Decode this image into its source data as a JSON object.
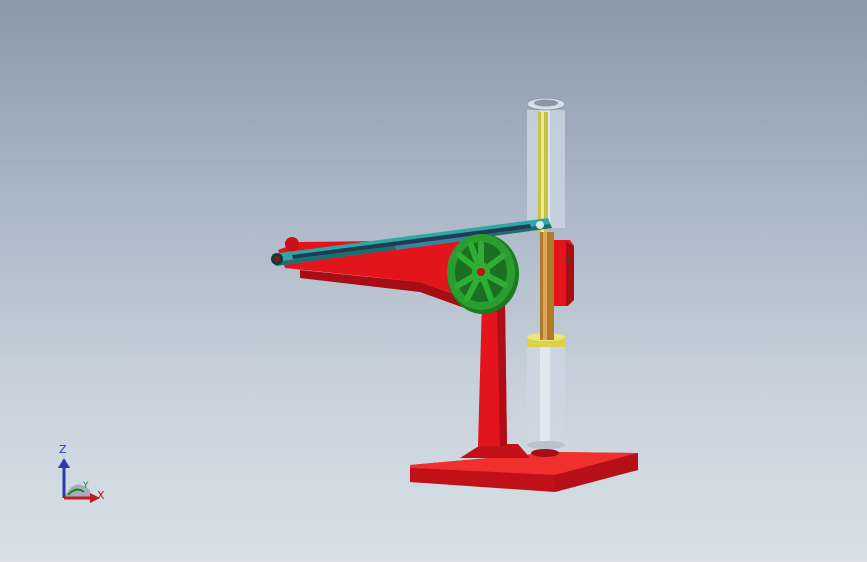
{
  "viewport": {
    "background_top": "#8a98aa",
    "background_bottom": "#d8dfe6"
  },
  "model": {
    "colors": {
      "frame_red": "#e3141c",
      "frame_red_dark": "#a80d14",
      "arm_teal": "#2fa7a6",
      "wheel_green": "#2b9c2f",
      "rod_yellow": "#c9c24a",
      "tube_glass": "#c9d3e0",
      "brass": "#b07a2a"
    },
    "icons": [
      "red-frame",
      "teal-linkage-arm",
      "green-spoked-wheel",
      "glass-cylinder",
      "yellow-piston-rod"
    ]
  },
  "triad": {
    "z_label": "Z",
    "x_label": "X",
    "y_label": "Y",
    "icons": [
      "z-axis-arrow-icon",
      "x-axis-arrow-icon",
      "y-axis-arc-icon"
    ]
  }
}
